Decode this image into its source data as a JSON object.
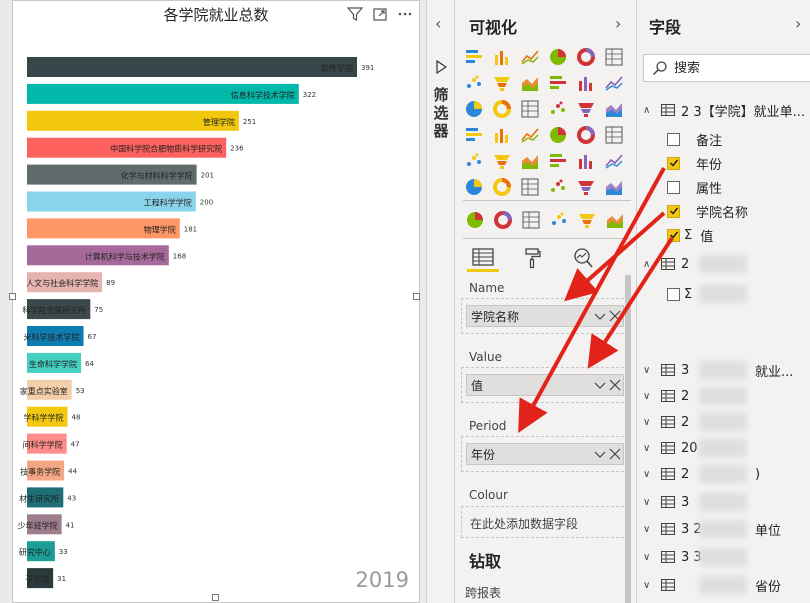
{
  "visual": {
    "title": "各学院就业总数",
    "period_label": "2019",
    "icons": [
      "filter-icon",
      "focus-mode-icon",
      "more-options-icon"
    ]
  },
  "chart_data": {
    "type": "bar",
    "orientation": "horizontal",
    "title": "各学院就业总数",
    "categories": [
      "软件学院",
      "信息科学技术学院",
      "管理学院",
      "中国科学院合肥物质科学研究院",
      "化学与材料科学学院",
      "工程科学学院",
      "物理学院",
      "计算机科学与技术学院",
      "人文与社会科学学院",
      "科学院金属研究所",
      "米科学技术学院",
      "生命科学学院",
      "家重点实验室",
      "学科学学院",
      "间科学学院",
      "技事务学院",
      "材生研究所",
      "少年班学院",
      "研究中心",
      "子学院"
    ],
    "values": [
      391,
      322,
      251,
      236,
      201,
      200,
      181,
      168,
      89,
      75,
      67,
      64,
      53,
      48,
      47,
      44,
      43,
      41,
      33,
      31
    ],
    "colors": [
      "#374649",
      "#01b8aa",
      "#f2c80f",
      "#fd625e",
      "#5f6b6d",
      "#8ad4eb",
      "#fe9666",
      "#a66999",
      "#e6b4b0",
      "#3c4a4d",
      "#0f7cb0",
      "#44cfc1",
      "#f2cfaa",
      "#f2c811",
      "#fc8d8a",
      "#f4a784",
      "#1f6f78",
      "#9e7d8c",
      "#1c9e96",
      "#2b3a3c"
    ],
    "xlim": [
      0,
      400
    ],
    "grid": false,
    "legend": "none",
    "period": "2019"
  },
  "viz_pane": {
    "filters_label": "筛选器",
    "title": "可视化",
    "gallery_icons": [
      "stacked-bar-icon",
      "stacked-column-icon",
      "clustered-bar-icon",
      "clustered-column-icon",
      "100-stacked-bar-icon",
      "100-stacked-column-icon",
      "line-chart-icon",
      "area-chart-icon",
      "stacked-area-icon",
      "line-column-icon",
      "line-clustered-column-icon",
      "ribbon-chart-icon",
      "waterfall-icon",
      "funnel-icon",
      "scatter-icon",
      "pie-icon",
      "donut-icon",
      "treemap-icon",
      "map-icon",
      "filled-map-icon",
      "gauge-icon",
      "card-icon",
      "multirow-card-icon",
      "kpi-icon",
      "slicer-icon",
      "table-icon",
      "matrix-icon",
      "r-visual-icon",
      "python-visual-icon",
      "key-influencers-icon",
      "globe-map-icon",
      "powerapps-icon",
      "bullet-chart-icon",
      "bar-chart-race-icon",
      "hexbin-icon",
      "more-visuals-icon"
    ],
    "custom_icons": [
      "play-axis-icon",
      "line-sparkline-icon",
      "dot-plot-icon",
      "dot-matrix-icon",
      "table-heatmap-icon",
      "play-button-icon"
    ],
    "tabs": [
      "fields-tab",
      "format-tab",
      "analytics-tab"
    ],
    "wells": {
      "name": {
        "label": "Name",
        "value": "学院名称"
      },
      "value": {
        "label": "Value",
        "value": "值"
      },
      "period": {
        "label": "Period",
        "value": "年份"
      },
      "colour": {
        "label": "Colour",
        "placeholder": "在此处添加数据字段"
      }
    },
    "drill_title": "钻取",
    "cross_report": "跨报表"
  },
  "fields_pane": {
    "title": "字段",
    "search_placeholder": "搜索",
    "expanded_table": "2 3【学院】就业单...",
    "fields": [
      {
        "name": "备注",
        "checked": false,
        "sigma": false
      },
      {
        "name": "年份",
        "checked": true,
        "sigma": false
      },
      {
        "name": "属性",
        "checked": false,
        "sigma": false
      },
      {
        "name": "学院名称",
        "checked": true,
        "sigma": false
      },
      {
        "name": "值",
        "checked": true,
        "sigma": true
      }
    ],
    "other_tables": [
      {
        "text": "2"
      },
      {
        "text": "",
        "sigma_row": "Σ"
      },
      {
        "text": "3",
        "suffix": "就业..."
      },
      {
        "text": "2"
      },
      {
        "text": "2"
      },
      {
        "text": "20"
      },
      {
        "text": "2",
        "suffix": ")"
      },
      {
        "text": "3"
      },
      {
        "text": "3 2",
        "suffix": "单位"
      },
      {
        "text": "3 3"
      },
      {
        "text": "",
        "suffix": "省份"
      }
    ]
  }
}
